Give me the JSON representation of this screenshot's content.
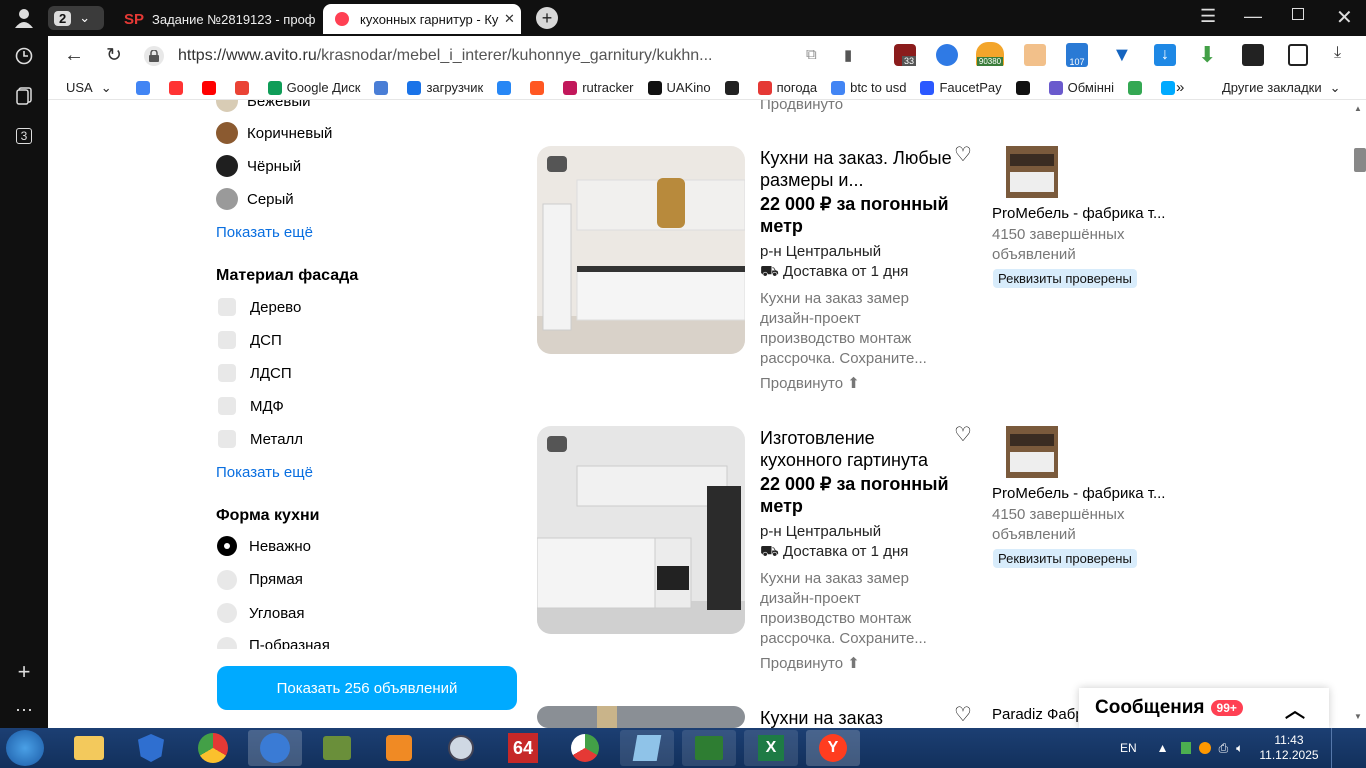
{
  "browser": {
    "tab_counter": "2",
    "tab1_title": "Задание №2819123 - проф",
    "tab2_title": "кухонных гарнитур - Ку",
    "url_prefix": "https://www.avito.ru",
    "url_path": "/krasnodar/mebel_i_interer/kuhonnye_garnitury/kukhn...",
    "rail_badge": "3",
    "ext_badge1": "33",
    "ext_badge2": "90380",
    "ext_badge3": "107"
  },
  "bookmarks": [
    {
      "label": "USA",
      "color": "#ffffff"
    },
    {
      "label": "",
      "color": "#4285f4"
    },
    {
      "label": "",
      "color": "#ff3333"
    },
    {
      "label": "",
      "color": "#ff0000"
    },
    {
      "label": "",
      "color": "#ea4335"
    },
    {
      "label": "Google Диск",
      "color": "#0f9d58"
    },
    {
      "label": "",
      "color": "#4a7ed6"
    },
    {
      "label": "загрузчик",
      "color": "#1a73e8"
    },
    {
      "label": "",
      "color": "#2787f5"
    },
    {
      "label": "",
      "color": "#ff5722"
    },
    {
      "label": "rutracker",
      "color": "#c2185b"
    },
    {
      "label": "UAKino",
      "color": "#111111"
    },
    {
      "label": "",
      "color": "#222222"
    },
    {
      "label": "погода",
      "color": "#e53935"
    },
    {
      "label": "btc to usd",
      "color": "#4285f4"
    },
    {
      "label": "FaucetPay",
      "color": "#2b58ff"
    },
    {
      "label": "",
      "color": "#111111"
    },
    {
      "label": "Обмінні",
      "color": "#6a5acd"
    },
    {
      "label": "",
      "color": "#34a853"
    },
    {
      "label": "",
      "color": "#00aaff"
    }
  ],
  "bookmarks_more": "»",
  "bookmarks_other": "Другие закладки",
  "filters": {
    "colors": [
      {
        "label": "Бежевый",
        "hex": "#d8ccb5"
      },
      {
        "label": "Коричневый",
        "hex": "#8b5a30"
      },
      {
        "label": "Чёрный",
        "hex": "#1f1f1f"
      },
      {
        "label": "Серый",
        "hex": "#9a9a9a"
      }
    ],
    "show_more": "Показать ещё",
    "facade_title": "Материал фасада",
    "facade": [
      "Дерево",
      "ДСП",
      "ЛДСП",
      "МДФ",
      "Металл"
    ],
    "shape_title": "Форма кухни",
    "shapes": [
      {
        "label": "Неважно",
        "selected": true
      },
      {
        "label": "Прямая",
        "selected": false
      },
      {
        "label": "Угловая",
        "selected": false
      },
      {
        "label": "П-образная",
        "selected": false
      }
    ],
    "show_button": "Показать 256 объявлений"
  },
  "top_promoted": "Продвинуто",
  "listings": [
    {
      "title": "Кухни на заказ. Любые размеры и...",
      "price": "22 000 ₽ за погонный метр",
      "location": "р-н Центральный",
      "delivery": "Доставка от 1 дня",
      "description": "Кухни на заказ замер дизайн-проект производство монтаж рассрочка. Сохраните...",
      "promoted": "Продвинуто",
      "seller": "ProМебель - фабрика т...",
      "seller_count": "4150 завершённых объявлений",
      "badge": "Реквизиты проверены"
    },
    {
      "title": "Изготовление кухонного гартинута",
      "price": "22 000 ₽ за погонный метр",
      "location": "р-н Центральный",
      "delivery": "Доставка от 1 дня",
      "description": "Кухни на заказ замер дизайн-проект производство монтаж рассрочка. Сохраните...",
      "promoted": "Продвинуто",
      "seller": "ProМебель - фабрика т...",
      "seller_count": "4150 завершённых объявлений",
      "badge": "Реквизиты проверены"
    },
    {
      "title": "Кухни на заказ",
      "seller": "Paradiz Фабр"
    }
  ],
  "messages": {
    "label": "Сообщения",
    "badge": "99+"
  },
  "tray": {
    "lang": "EN",
    "time": "11:43",
    "date": "11.12.2025"
  },
  "taskbar": {
    "badge_64": "64"
  }
}
